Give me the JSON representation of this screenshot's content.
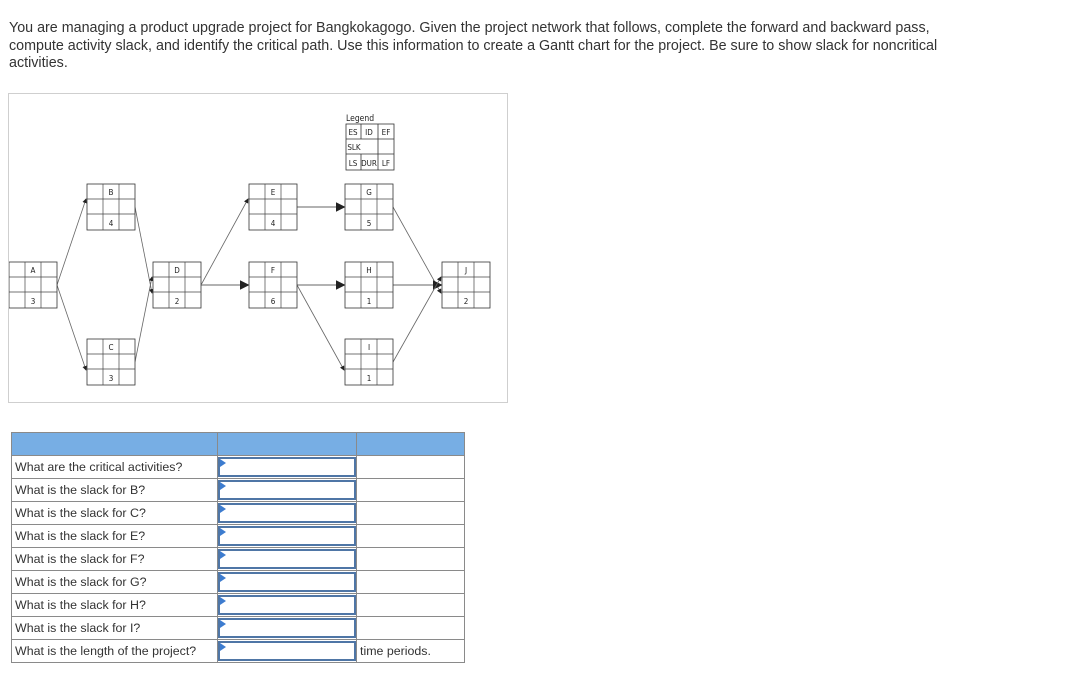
{
  "prompt": {
    "text": "You are managing a product upgrade project for Bangkokagogo. Given the project network that follows, complete the forward and backward pass, compute activity slack, and identify the critical path. Use this information to create a Gantt chart for the project. Be sure to show slack for noncritical activities."
  },
  "network": {
    "legend": {
      "title": "Legend",
      "row1": [
        "ES",
        "ID",
        "EF"
      ],
      "row2": [
        "SLK",
        "",
        ""
      ],
      "row3": [
        "LS",
        "DUR",
        "LF"
      ]
    },
    "activities": [
      {
        "id": "A",
        "duration": "3"
      },
      {
        "id": "B",
        "duration": "4"
      },
      {
        "id": "C",
        "duration": "3"
      },
      {
        "id": "D",
        "duration": "2"
      },
      {
        "id": "E",
        "duration": "4"
      },
      {
        "id": "F",
        "duration": "6"
      },
      {
        "id": "G",
        "duration": "5"
      },
      {
        "id": "H",
        "duration": "1"
      },
      {
        "id": "I",
        "duration": "1"
      },
      {
        "id": "J",
        "duration": "2"
      }
    ],
    "edges": [
      [
        "A",
        "B"
      ],
      [
        "A",
        "C"
      ],
      [
        "B",
        "D"
      ],
      [
        "C",
        "D"
      ],
      [
        "D",
        "E"
      ],
      [
        "D",
        "F"
      ],
      [
        "E",
        "G"
      ],
      [
        "F",
        "H"
      ],
      [
        "F",
        "I"
      ],
      [
        "G",
        "J"
      ],
      [
        "H",
        "J"
      ],
      [
        "I",
        "J"
      ]
    ]
  },
  "table": {
    "header": [
      "",
      "",
      ""
    ],
    "rows": [
      {
        "question": "What are the critical activities?",
        "value": "",
        "unit": ""
      },
      {
        "question": "What is the slack for B?",
        "value": "",
        "unit": ""
      },
      {
        "question": "What is the slack for C?",
        "value": "",
        "unit": ""
      },
      {
        "question": "What is the slack for E?",
        "value": "",
        "unit": ""
      },
      {
        "question": "What is the slack for F?",
        "value": "",
        "unit": ""
      },
      {
        "question": "What is the slack for G?",
        "value": "",
        "unit": ""
      },
      {
        "question": "What is the slack for H?",
        "value": "",
        "unit": ""
      },
      {
        "question": "What is the slack for I?",
        "value": "",
        "unit": ""
      },
      {
        "question": "What is the length of the project?",
        "value": "",
        "unit": "time periods."
      }
    ]
  },
  "colors": {
    "header_bg": "#77aee4",
    "input_border": "#4f76a6",
    "flag": "#3d7ccf"
  }
}
